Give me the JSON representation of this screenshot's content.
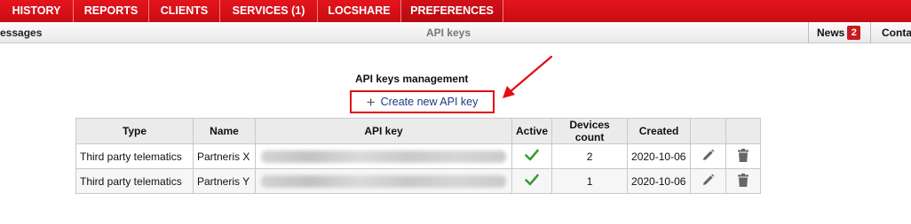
{
  "topnav": {
    "items": [
      {
        "label": "HISTORY",
        "active": false
      },
      {
        "label": "REPORTS",
        "active": false
      },
      {
        "label": "CLIENTS",
        "active": false
      },
      {
        "label": "SERVICES (1)",
        "active": false
      },
      {
        "label": "LOCSHARE",
        "active": false
      },
      {
        "label": "PREFERENCES",
        "active": true
      }
    ]
  },
  "subbar": {
    "messages_label": "essages",
    "title": "API keys",
    "news_label": "News",
    "news_count": "2",
    "contact_label": "Conta"
  },
  "main": {
    "heading": "API keys management",
    "create_button": {
      "icon": "plus-icon",
      "label": "Create new API key"
    },
    "table": {
      "headers": [
        "Type",
        "Name",
        "API key",
        "Active",
        "Devices count",
        "Created",
        "",
        ""
      ],
      "rows": [
        {
          "type": "Third party telematics",
          "name": "Partneris X",
          "api_key": "",
          "active": true,
          "devices_count": "2",
          "created": "2020-10-06"
        },
        {
          "type": "Third party telematics",
          "name": "Partneris Y",
          "api_key": "",
          "active": true,
          "devices_count": "1",
          "created": "2020-10-06"
        }
      ]
    }
  },
  "colors": {
    "nav_red": "#d3111a",
    "highlight_red": "#e30d16",
    "link_blue": "#1a3b80",
    "check_green": "#3b9a3b"
  }
}
